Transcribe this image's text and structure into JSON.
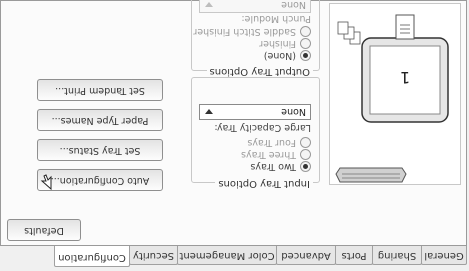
{
  "tabs": [
    "General",
    "Sharing",
    "Ports",
    "Advanced",
    "Color Management",
    "Security",
    "Configuration"
  ],
  "defaults_button": "Defaults",
  "input_tray": {
    "title": "Input Tray Options",
    "options": [
      "Two Trays",
      "Three Trays",
      "Four Trays"
    ],
    "large_capacity_label": "Large Capacity Tray:",
    "large_capacity_value": "None"
  },
  "output_tray": {
    "title": "Output Tray Options",
    "options": [
      "(None)",
      "Finisher",
      "Saddle Stitch Finisher"
    ],
    "punch_label": "Punch Module:",
    "punch_value": "None"
  },
  "buttons": [
    "Auto Configuration...",
    "Set Tray Status...",
    "Paper Type Names...",
    "Set Tandem Print..."
  ],
  "preview": {
    "page_number": "1"
  }
}
